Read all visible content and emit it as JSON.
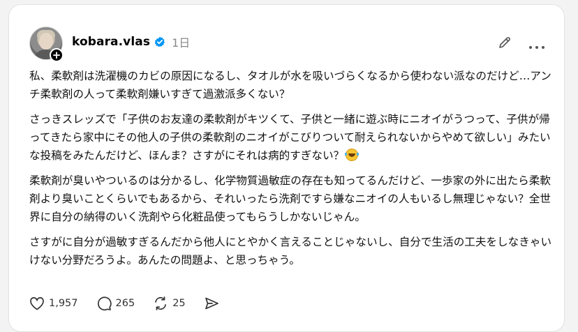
{
  "post": {
    "username": "kobara.vlas",
    "time": "1日",
    "paragraphs": [
      "私、柔軟剤は洗濯機のカビの原因になるし、タオルが水を吸いづらくなるから使わない派なのだけど…アンチ柔軟剤の人って柔軟剤嫌いすぎて過激派多くない？",
      "さっきスレッズで「子供のお友達の柔軟剤がキツくて、子供と一緒に遊ぶ時にニオイがうつって、子供が帰ってきたら家中にその他人の子供の柔軟剤のニオイがこびりついて耐えられないからやめて欲しい」みたいな投稿をみたんだけど、ほんま？さすがにそれは病的すぎない？",
      "柔軟剤が臭いやついるのは分かるし、化学物質過敏症の存在も知ってるんだけど、一歩家の外に出たら柔軟剤より臭いことくらいでもあるから、それいったら洗剤ですら嫌なニオイの人もいるし無理じゃない？全世界に自分の納得のいく洗剤やら化粧品使ってもらうしかないじゃん。",
      "さすがに自分が過敏すぎるんだから他人にとやかく言えることじゃないし、自分で生活の工夫をしなきゃいけない分野だろうよ。あんたの問題よ、と思っちゃう。"
    ]
  },
  "actions": {
    "likes": "1,957",
    "replies": "265",
    "reposts": "25"
  },
  "colors": {
    "verified": "#0095f6",
    "muted": "#8a8a8a"
  },
  "icons": [
    "avatar",
    "plus-icon",
    "verified-badge-icon",
    "edit-icon",
    "more-icon",
    "heart-icon",
    "comment-icon",
    "repost-icon",
    "share-icon",
    "laughing-emoji-icon"
  ]
}
